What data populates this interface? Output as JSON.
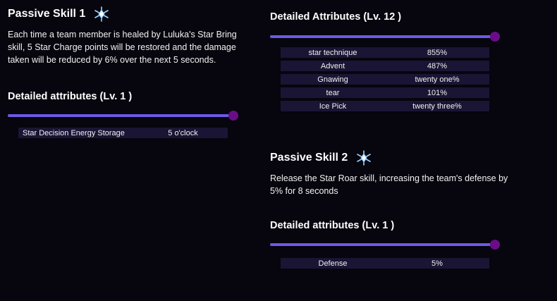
{
  "skill1": {
    "title": "Passive Skill 1",
    "icon": "crystal-snowflake-icon",
    "description": "Each time a team member is healed by Luluka's Star Bring skill, 5 Star Charge points will be restored and the damage taken will be reduced by 6% over the next 5 seconds.",
    "attributes_title": "Detailed attributes (Lv. 1 )",
    "slider_value": 1.0,
    "attributes": [
      {
        "name": "Star Decision Energy Storage",
        "value": "5 o'clock"
      }
    ]
  },
  "detailed12": {
    "attributes_title": "Detailed Attributes (Lv. 12 )",
    "slider_value": 1.0,
    "attributes": [
      {
        "name": "star technique",
        "value": "855%"
      },
      {
        "name": "Advent",
        "value": "487%"
      },
      {
        "name": "Gnawing",
        "value": "twenty one%"
      },
      {
        "name": "tear",
        "value": "101%"
      },
      {
        "name": "Ice Pick",
        "value": "twenty three%"
      }
    ]
  },
  "skill2": {
    "title": "Passive Skill 2",
    "icon": "crystal-snowflake-icon",
    "description": "Release the Star Roar skill, increasing the team's defense by 5% for 8 seconds",
    "attributes_title": "Detailed attributes (Lv. 1 )",
    "slider_value": 1.0,
    "attributes": [
      {
        "name": "Defense",
        "value": "5%"
      }
    ]
  },
  "colors": {
    "background": "#07050d",
    "slider_track": "#6b5ae6",
    "slider_knob": "#6a0d88",
    "row_background": "#1a1534"
  }
}
